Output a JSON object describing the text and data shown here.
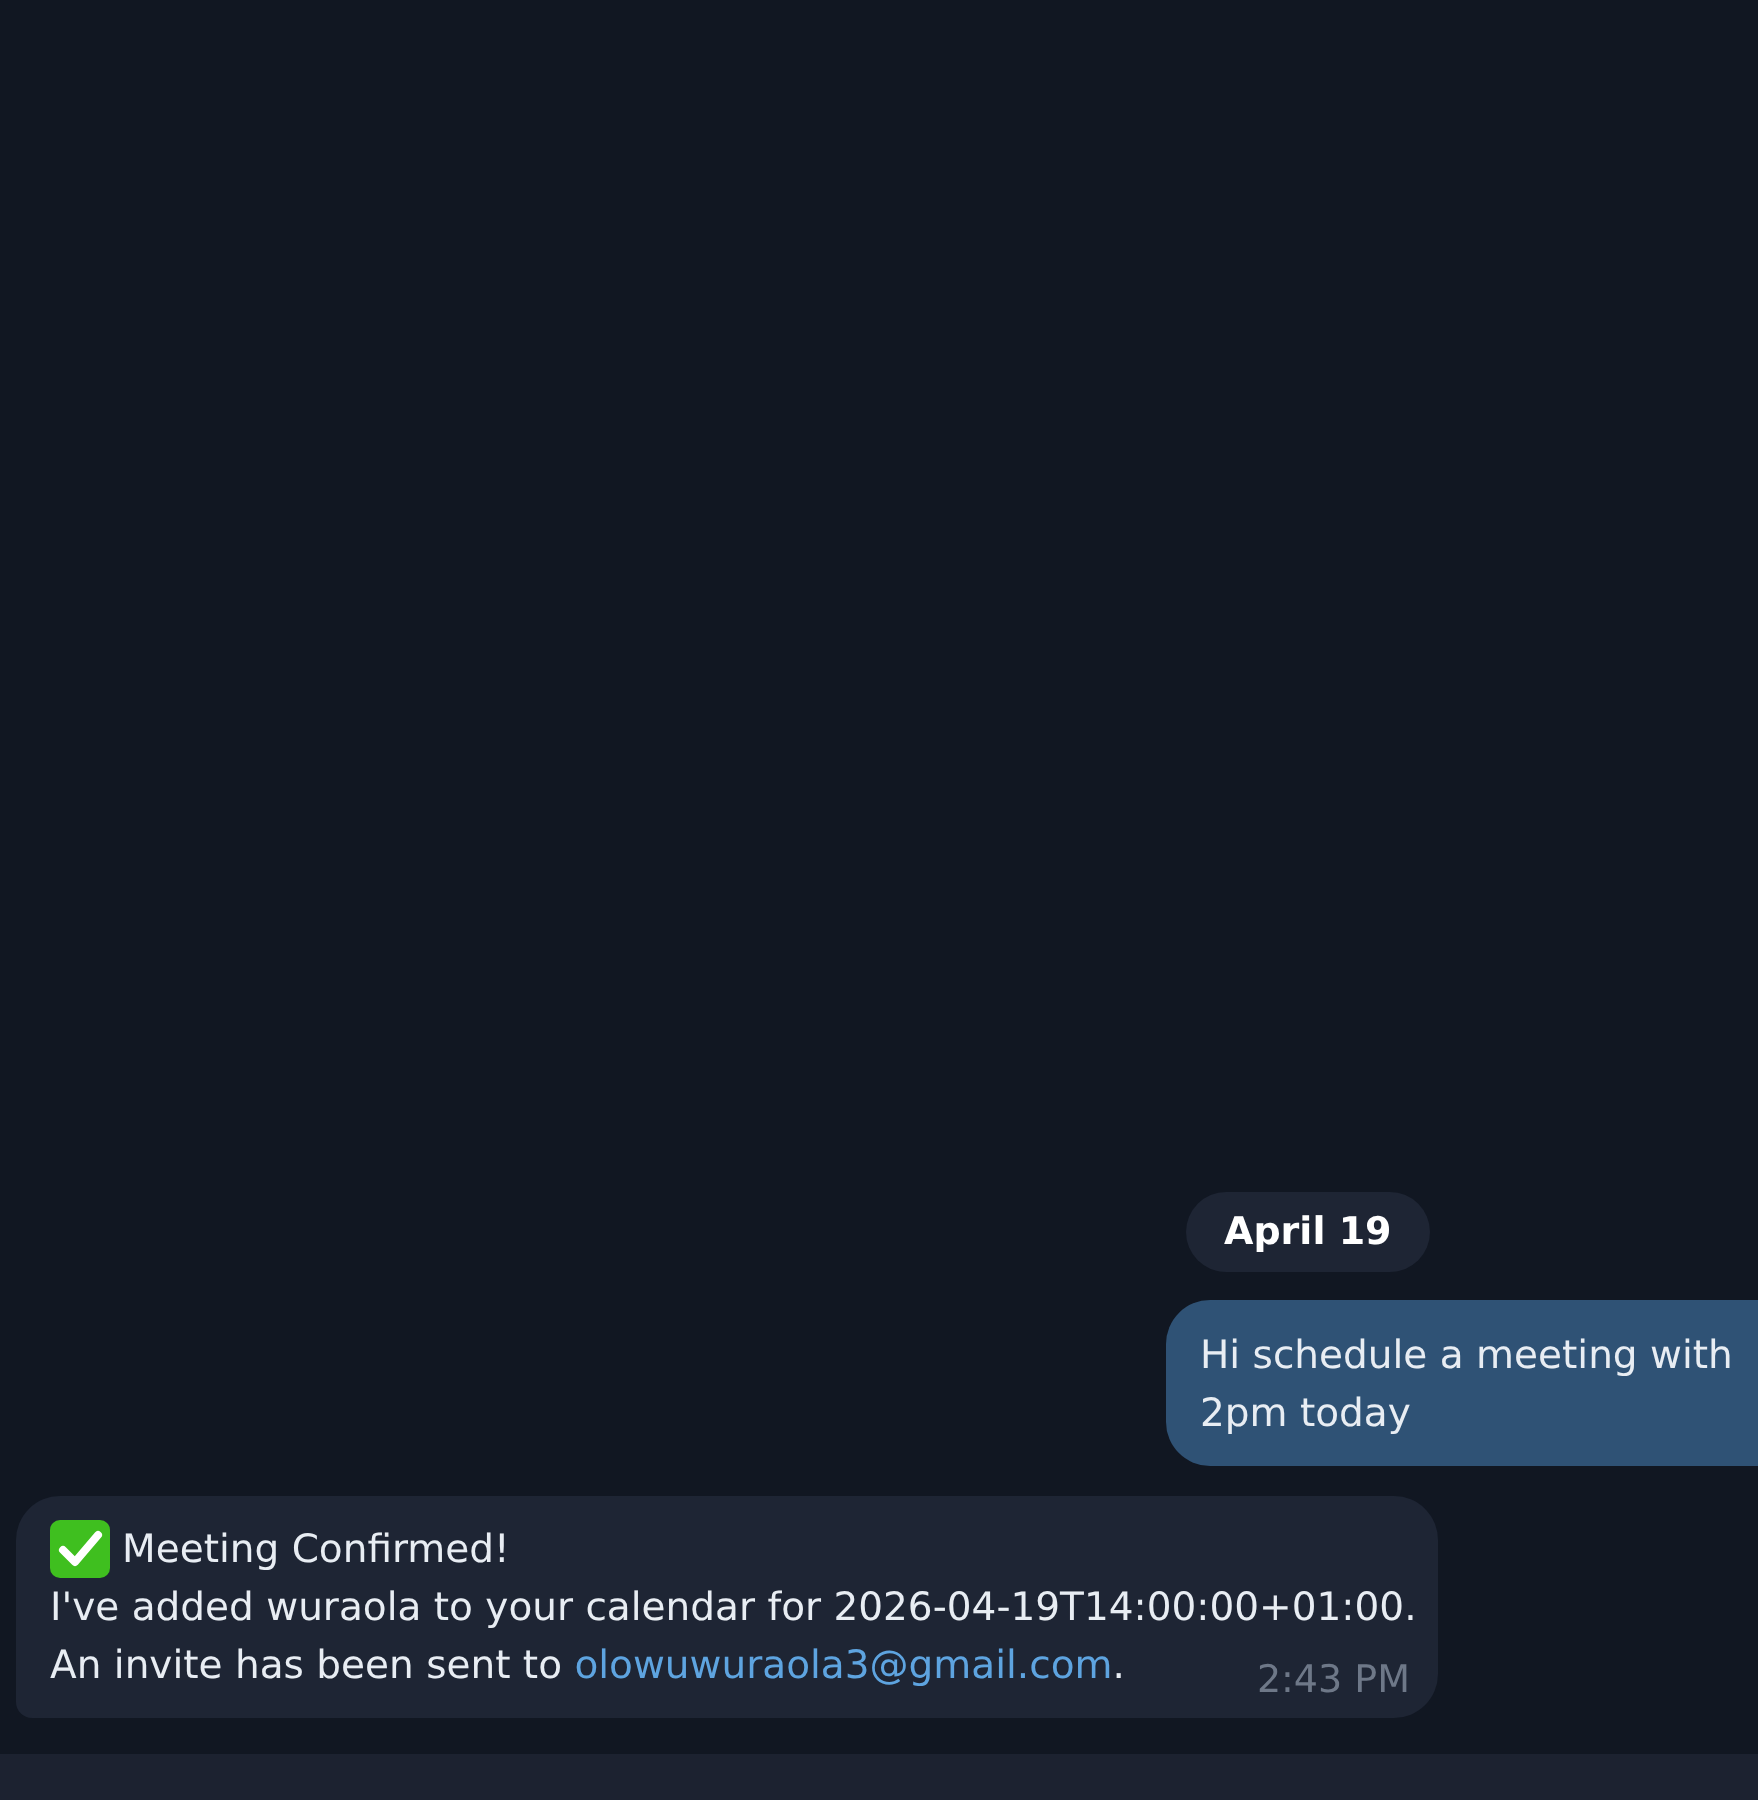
{
  "date_divider": {
    "label": "April 19"
  },
  "messages": [
    {
      "kind": "outgoing",
      "lines": [
        "Hi schedule a meeting with",
        "2pm today"
      ]
    },
    {
      "kind": "incoming",
      "title": "Meeting Confirmed!",
      "lines": [
        {
          "text": "I've added wuraola to your calendar for 2026-04-19T14:00:00+01:00."
        },
        {
          "text": "An invite has been sent to ",
          "link": "olowuwuraola3@gmail.com",
          "after": "."
        }
      ],
      "time": "2:43 PM"
    }
  ]
}
